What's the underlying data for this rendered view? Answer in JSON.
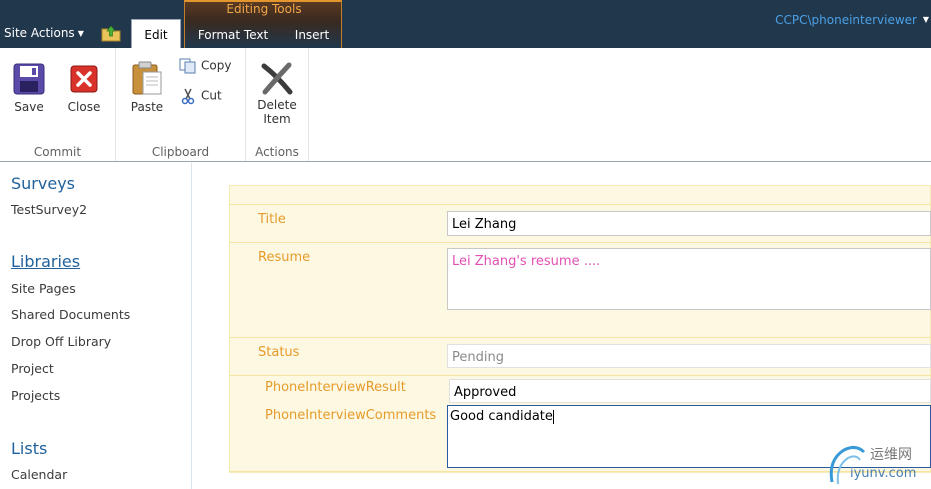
{
  "topbar": {
    "site_actions": "Site Actions",
    "tabs": [
      "Edit",
      "Format Text",
      "Insert"
    ],
    "contextual_group": "Editing Tools",
    "user": "CCPC\\phoneinterviewer"
  },
  "ribbon": {
    "groups": {
      "commit": "Commit",
      "clipboard": "Clipboard",
      "actions": "Actions"
    },
    "buttons": {
      "save": "Save",
      "close": "Close",
      "paste": "Paste",
      "copy": "Copy",
      "cut": "Cut",
      "delete_line1": "Delete",
      "delete_line2": "Item"
    }
  },
  "leftnav": {
    "surveys": "Surveys",
    "survey_items": [
      "TestSurvey2"
    ],
    "libraries": "Libraries",
    "library_items": [
      "Site Pages",
      "Shared Documents",
      "Drop Off Library",
      "Project",
      "Projects"
    ],
    "lists": "Lists",
    "list_items": [
      "Calendar"
    ]
  },
  "form": {
    "title_label": "Title",
    "title_value": "Lei Zhang",
    "resume_label": "Resume",
    "resume_value": "Lei Zhang's resume ....",
    "status_label": "Status",
    "status_value": "Pending",
    "result_label": "PhoneInterviewResult",
    "result_value": "Approved",
    "comments_label": "PhoneInterviewComments",
    "comments_value": "Good candidate"
  },
  "watermark": {
    "cn": "运维网",
    "en": "iyunv.com"
  },
  "colors": {
    "topbar_bg": "#21374c",
    "accent_orange": "#e69b2a",
    "link_blue": "#21629c",
    "form_bg": "#fdf8e2"
  }
}
